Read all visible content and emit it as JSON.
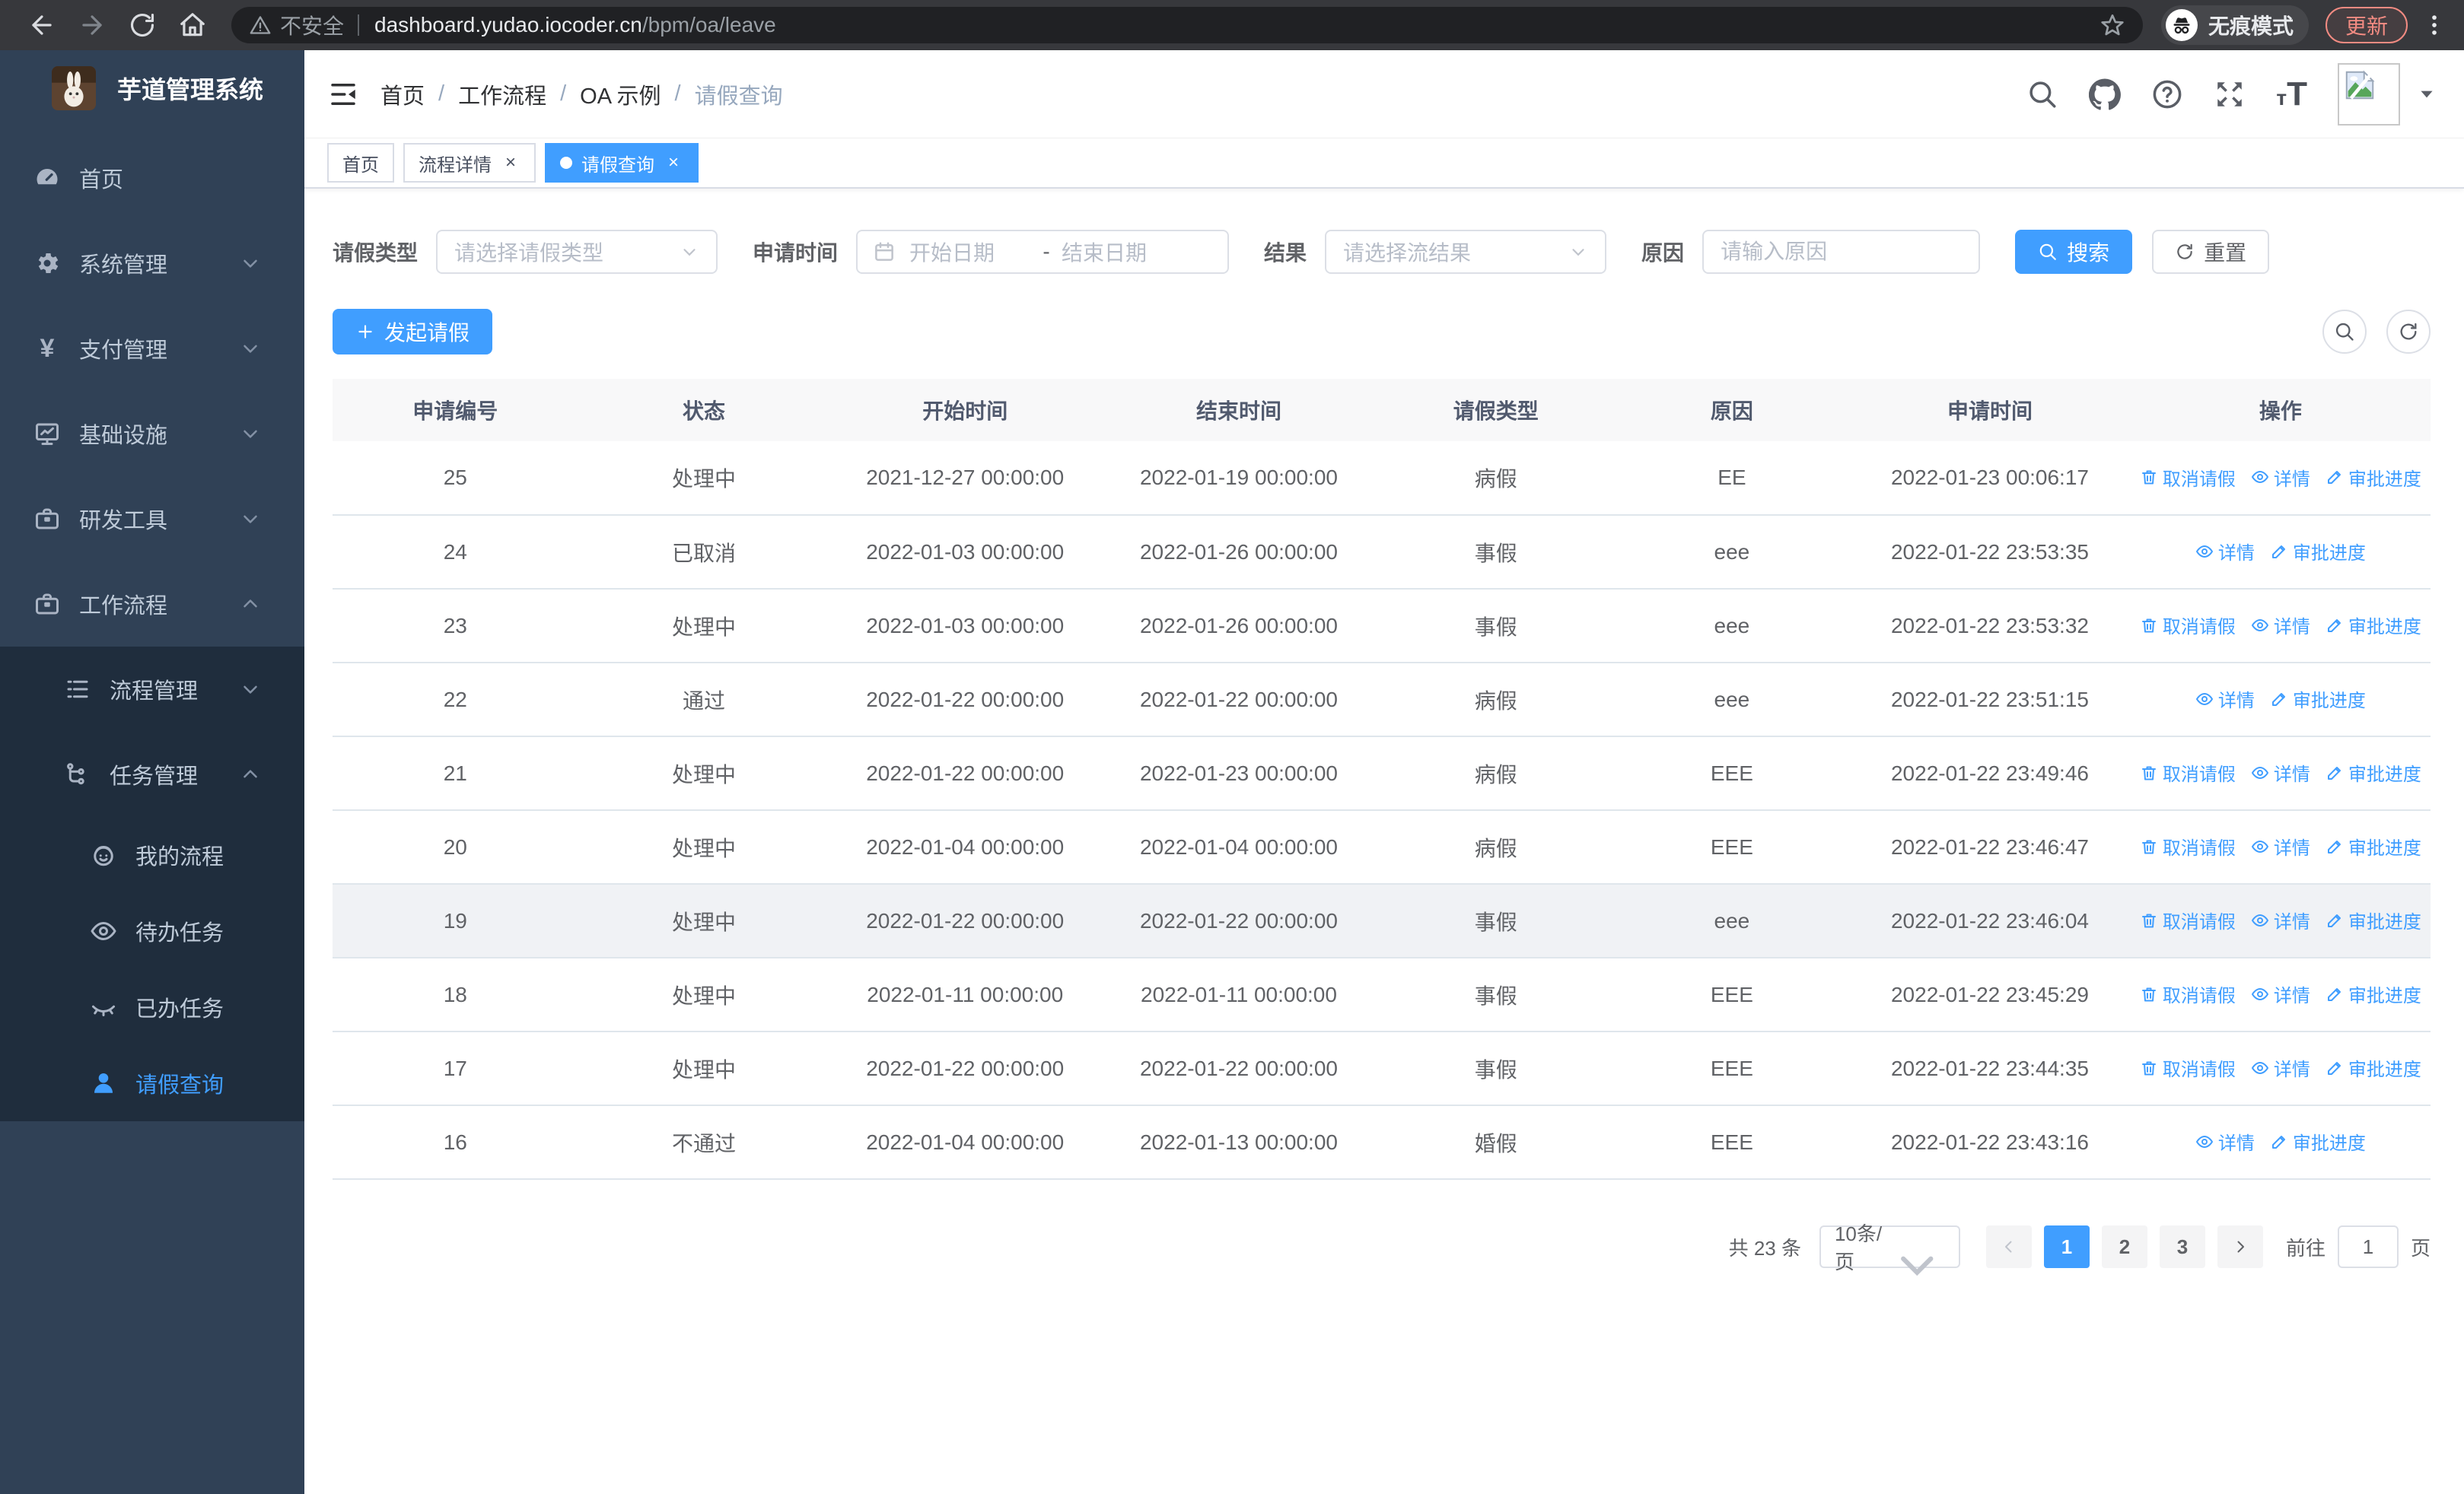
{
  "colors": {
    "accent": "#409eff",
    "sidebar_bg": "#304156",
    "submenu_bg": "#1f2d3d",
    "update_red": "#f28b82"
  },
  "browser": {
    "security_text": "不安全",
    "url_host": "dashboard.yudao.iocoder.cn",
    "url_path": "/bpm/oa/leave",
    "incognito_label": "无痕模式",
    "update_label": "更新"
  },
  "sidebar": {
    "title": "芋道管理系统",
    "items": [
      {
        "key": "home",
        "label": "首页",
        "icon": "dashboard",
        "level": 1
      },
      {
        "key": "system",
        "label": "系统管理",
        "icon": "gear",
        "level": 1,
        "chevron": "down"
      },
      {
        "key": "payment",
        "label": "支付管理",
        "icon": "yen",
        "level": 1,
        "chevron": "down"
      },
      {
        "key": "infra",
        "label": "基础设施",
        "icon": "monitor",
        "level": 1,
        "chevron": "down"
      },
      {
        "key": "devtools",
        "label": "研发工具",
        "icon": "briefcase",
        "level": 1,
        "chevron": "down"
      },
      {
        "key": "workflow",
        "label": "工作流程",
        "icon": "briefcase",
        "level": 1,
        "chevron": "up"
      },
      {
        "key": "process-mgmt",
        "label": "流程管理",
        "icon": "list",
        "level": 2,
        "chevron": "down"
      },
      {
        "key": "task-mgmt",
        "label": "任务管理",
        "icon": "tree",
        "level": 2,
        "chevron": "up"
      },
      {
        "key": "my-process",
        "label": "我的流程",
        "icon": "face",
        "level": 3
      },
      {
        "key": "todo-tasks",
        "label": "待办任务",
        "icon": "eye",
        "level": 3
      },
      {
        "key": "done-tasks",
        "label": "已办任务",
        "icon": "eyeclosed",
        "level": 3
      },
      {
        "key": "leave-query",
        "label": "请假查询",
        "icon": "user",
        "level": 3,
        "active": true
      }
    ]
  },
  "header": {
    "breadcrumb": [
      "首页",
      "工作流程",
      "OA 示例",
      "请假查询"
    ]
  },
  "tabs": [
    {
      "label": "首页",
      "closable": false,
      "active": false
    },
    {
      "label": "流程详情",
      "closable": true,
      "active": false
    },
    {
      "label": "请假查询",
      "closable": true,
      "active": true
    }
  ],
  "filters": {
    "leave_type_label": "请假类型",
    "leave_type_placeholder": "请选择请假类型",
    "apply_time_label": "申请时间",
    "date_start_placeholder": "开始日期",
    "date_separator": "-",
    "date_end_placeholder": "结束日期",
    "result_label": "结果",
    "result_placeholder": "请选择流结果",
    "reason_label": "原因",
    "reason_placeholder": "请输入原因",
    "search_label": "搜索",
    "reset_label": "重置"
  },
  "toolbar": {
    "create_label": "发起请假"
  },
  "table": {
    "columns": [
      "申请编号",
      "状态",
      "开始时间",
      "结束时间",
      "请假类型",
      "原因",
      "申请时间",
      "操作"
    ],
    "action_labels": {
      "cancel": "取消请假",
      "detail": "详情",
      "progress": "审批进度"
    },
    "rows": [
      {
        "id": "25",
        "status": "处理中",
        "start": "2021-12-27 00:00:00",
        "end": "2022-01-19 00:00:00",
        "type": "病假",
        "reason": "EE",
        "applied": "2022-01-23 00:06:17",
        "actions": [
          "cancel",
          "detail",
          "progress"
        ],
        "highlight": false
      },
      {
        "id": "24",
        "status": "已取消",
        "start": "2022-01-03 00:00:00",
        "end": "2022-01-26 00:00:00",
        "type": "事假",
        "reason": "eee",
        "applied": "2022-01-22 23:53:35",
        "actions": [
          "detail",
          "progress"
        ],
        "highlight": false
      },
      {
        "id": "23",
        "status": "处理中",
        "start": "2022-01-03 00:00:00",
        "end": "2022-01-26 00:00:00",
        "type": "事假",
        "reason": "eee",
        "applied": "2022-01-22 23:53:32",
        "actions": [
          "cancel",
          "detail",
          "progress"
        ],
        "highlight": false
      },
      {
        "id": "22",
        "status": "通过",
        "start": "2022-01-22 00:00:00",
        "end": "2022-01-22 00:00:00",
        "type": "病假",
        "reason": "eee",
        "applied": "2022-01-22 23:51:15",
        "actions": [
          "detail",
          "progress"
        ],
        "highlight": false
      },
      {
        "id": "21",
        "status": "处理中",
        "start": "2022-01-22 00:00:00",
        "end": "2022-01-23 00:00:00",
        "type": "病假",
        "reason": "EEE",
        "applied": "2022-01-22 23:49:46",
        "actions": [
          "cancel",
          "detail",
          "progress"
        ],
        "highlight": false
      },
      {
        "id": "20",
        "status": "处理中",
        "start": "2022-01-04 00:00:00",
        "end": "2022-01-04 00:00:00",
        "type": "病假",
        "reason": "EEE",
        "applied": "2022-01-22 23:46:47",
        "actions": [
          "cancel",
          "detail",
          "progress"
        ],
        "highlight": false
      },
      {
        "id": "19",
        "status": "处理中",
        "start": "2022-01-22 00:00:00",
        "end": "2022-01-22 00:00:00",
        "type": "事假",
        "reason": "eee",
        "applied": "2022-01-22 23:46:04",
        "actions": [
          "cancel",
          "detail",
          "progress"
        ],
        "highlight": true
      },
      {
        "id": "18",
        "status": "处理中",
        "start": "2022-01-11 00:00:00",
        "end": "2022-01-11 00:00:00",
        "type": "事假",
        "reason": "EEE",
        "applied": "2022-01-22 23:45:29",
        "actions": [
          "cancel",
          "detail",
          "progress"
        ],
        "highlight": false
      },
      {
        "id": "17",
        "status": "处理中",
        "start": "2022-01-22 00:00:00",
        "end": "2022-01-22 00:00:00",
        "type": "事假",
        "reason": "EEE",
        "applied": "2022-01-22 23:44:35",
        "actions": [
          "cancel",
          "detail",
          "progress"
        ],
        "highlight": false
      },
      {
        "id": "16",
        "status": "不通过",
        "start": "2022-01-04 00:00:00",
        "end": "2022-01-13 00:00:00",
        "type": "婚假",
        "reason": "EEE",
        "applied": "2022-01-22 23:43:16",
        "actions": [
          "detail",
          "progress"
        ],
        "highlight": false
      }
    ]
  },
  "pagination": {
    "total_text": "共 23 条",
    "page_size": "10条/页",
    "pages": [
      "1",
      "2",
      "3"
    ],
    "active_page": "1",
    "goto_label": "前往",
    "goto_value": "1",
    "goto_suffix": "页"
  }
}
